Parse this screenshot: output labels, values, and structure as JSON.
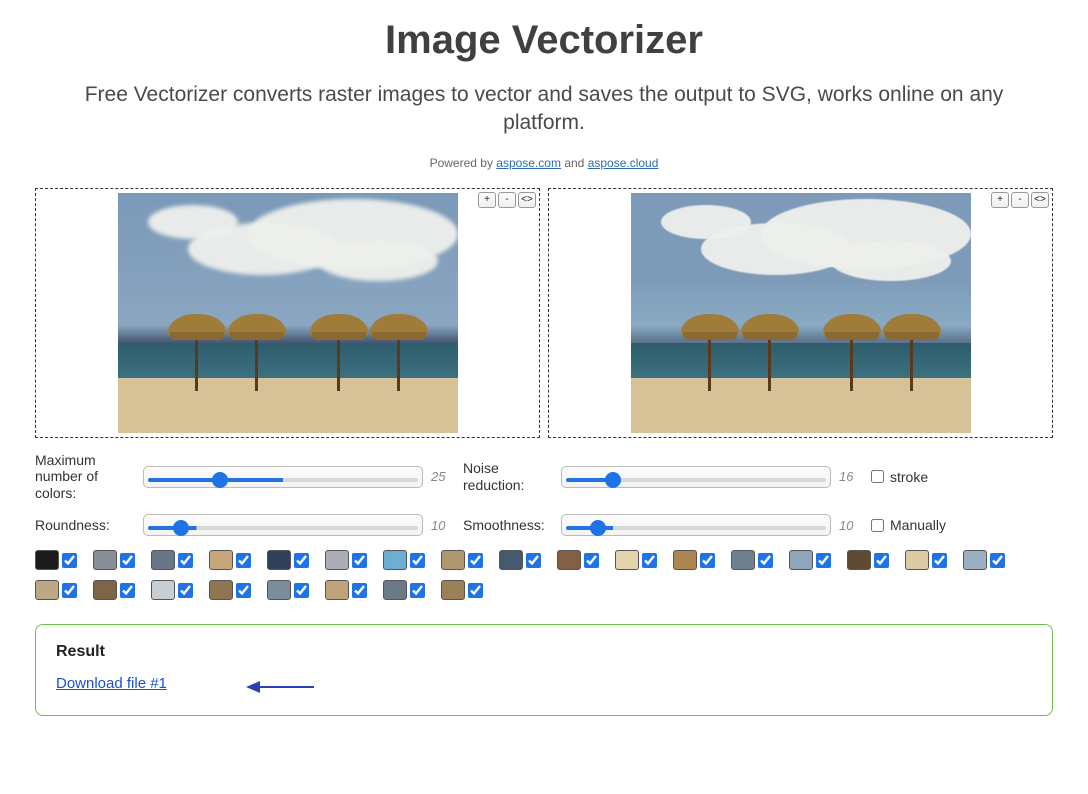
{
  "header": {
    "title": "Image Vectorizer",
    "subtitle": "Free Vectorizer converts raster images to vector and saves the output to SVG, works online on any platform.",
    "powered_prefix": "Powered by ",
    "powered_link1": "aspose.com",
    "powered_and": " and ",
    "powered_link2": "aspose.cloud"
  },
  "zoom": {
    "plus": "+",
    "minus": "-",
    "fit": "<>"
  },
  "controls": {
    "max_colors_label": "Maximum number of colors:",
    "max_colors_value": "25",
    "max_colors_pct": 50,
    "roundness_label": "Roundness:",
    "roundness_value": "10",
    "roundness_pct": 18,
    "noise_label": "Noise reduction:",
    "noise_value": "16",
    "noise_pct": 18,
    "smooth_label": "Smoothness:",
    "smooth_value": "10",
    "smooth_pct": 18,
    "stroke_label": "stroke",
    "manually_label": "Manually"
  },
  "swatches": [
    {
      "color": "#1b1b1b"
    },
    {
      "color": "#8a8e96"
    },
    {
      "color": "#667588"
    },
    {
      "color": "#c7a67c"
    },
    {
      "color": "#2e4158"
    },
    {
      "color": "#a9adb5"
    },
    {
      "color": "#6cafd4"
    },
    {
      "color": "#b09772"
    },
    {
      "color": "#465a6d"
    },
    {
      "color": "#826044"
    },
    {
      "color": "#e4d3ad"
    },
    {
      "color": "#ae8654"
    },
    {
      "color": "#6f818f"
    },
    {
      "color": "#8ea5bb"
    },
    {
      "color": "#5f4a33"
    },
    {
      "color": "#dccaa4"
    },
    {
      "color": "#9db0c1"
    },
    {
      "color": "#bca884"
    },
    {
      "color": "#7e6547"
    },
    {
      "color": "#c7cfd4"
    },
    {
      "color": "#8f7552"
    },
    {
      "color": "#7b8c9a"
    },
    {
      "color": "#c0a37b"
    },
    {
      "color": "#6c7a88"
    },
    {
      "color": "#9b7f57"
    }
  ],
  "result": {
    "heading": "Result",
    "download_label": "Download file #1"
  }
}
